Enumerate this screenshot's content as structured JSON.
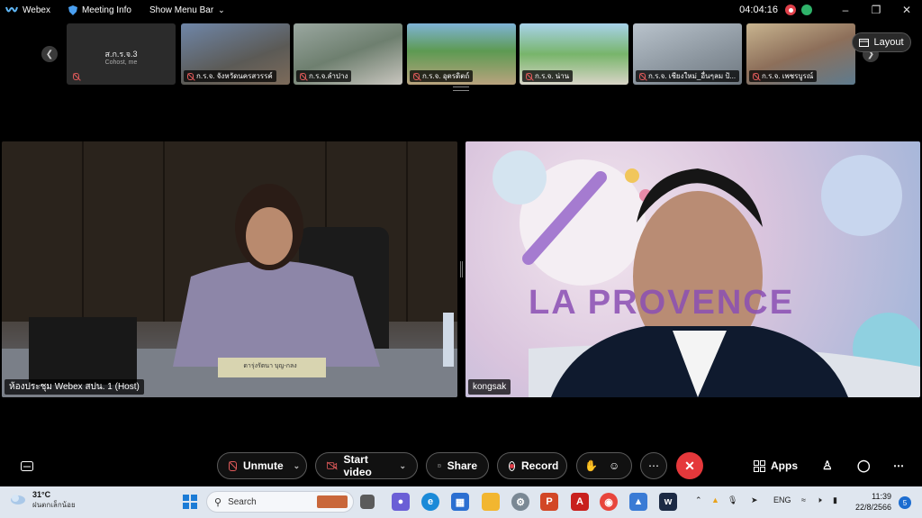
{
  "topbar": {
    "app_name": "Webex",
    "meeting_info": "Meeting Info",
    "show_menu_bar": "Show Menu Bar",
    "timer": "04:04:16"
  },
  "self_view": {
    "name": "ส.ก.ร.จ.3",
    "role": "Cohost, me"
  },
  "thumbnails": [
    {
      "label": "ก.ร.จ. จังหวัดนครสวรรค์"
    },
    {
      "label": "ก.ร.จ.ลำปาง"
    },
    {
      "label": "ก.ร.จ. อุตรดิตถ์"
    },
    {
      "label": "ก.ร.จ. น่าน"
    },
    {
      "label": "ก.ร.จ. เชียงใหม่_อื่นๆลม ป้..."
    },
    {
      "label": "ก.ร.จ. เพชรบูรณ์"
    }
  ],
  "layout_button": "Layout",
  "videos": [
    {
      "label": "ห้องประชุม Webex สปน. 1 (Host)",
      "nameplate": "ดารุ่งรัตนา บุญ-กลง"
    },
    {
      "label": "kongsak",
      "banner": "LA PROVENCE"
    }
  ],
  "controls": {
    "unmute": "Unmute",
    "start_video": "Start video",
    "share": "Share",
    "record": "Record",
    "apps": "Apps"
  },
  "taskbar": {
    "temperature": "31°C",
    "weather_loc": "ฝนตกเล็กน้อย",
    "search_placeholder": "Search",
    "lang": "ENG",
    "time": "11:39",
    "date": "22/8/2566",
    "notifications": "5"
  }
}
